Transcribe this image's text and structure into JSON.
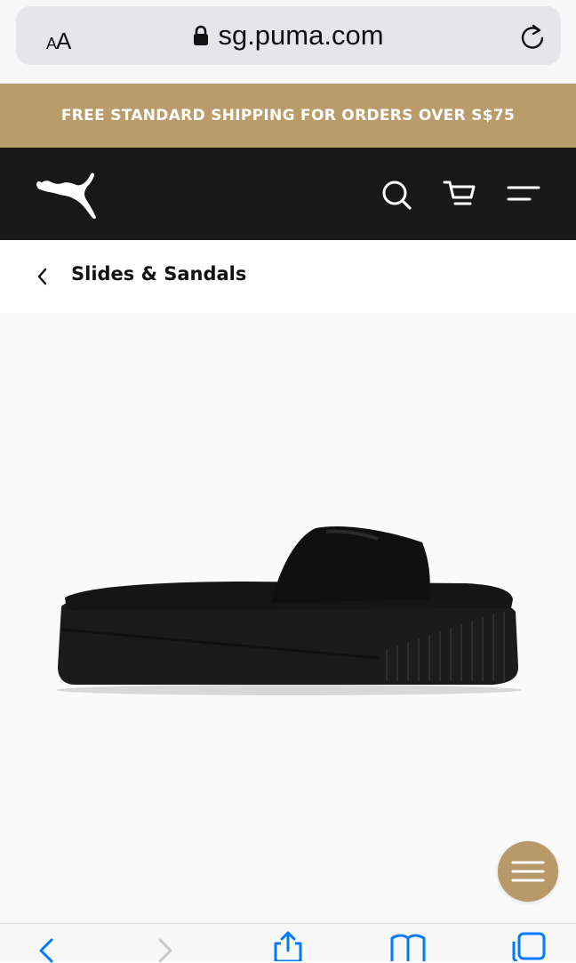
{
  "browser": {
    "text_size_small": "A",
    "text_size_large": "A",
    "url": "sg.puma.com",
    "icons": {
      "lock": "lock-icon",
      "reload": "reload-icon"
    }
  },
  "promo": {
    "text": "FREE STANDARD SHIPPING FOR ORDERS OVER S$75"
  },
  "nav": {
    "icons": [
      "puma-logo",
      "search-icon",
      "cart-icon",
      "menu-icon"
    ]
  },
  "breadcrumb": {
    "label": "Slides & Sandals"
  },
  "product": {
    "image": "black platform slide sandal"
  },
  "fab": {
    "icon": "menu-icon"
  },
  "toolbar": {
    "icons": [
      "back-icon",
      "forward-icon",
      "share-icon",
      "bookmarks-icon",
      "tabs-icon"
    ],
    "accent": "#007aff"
  },
  "colors": {
    "promo_bg": "#ba9b6a",
    "nav_bg": "#181818",
    "fab_bg": "#b89a6a"
  }
}
